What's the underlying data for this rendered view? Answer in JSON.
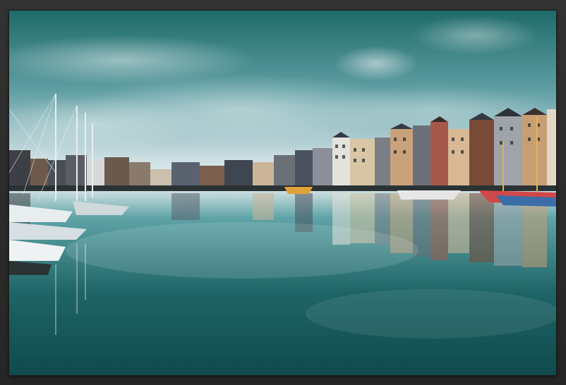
{
  "photo": {
    "scene": "harbor",
    "colors": {
      "frame": "#2b2b2b",
      "sky_top": "#1f6b6a",
      "sky_light": "#d7e6ea",
      "water_dark": "#0f4a4c",
      "water_light": "#5ea3a6"
    }
  }
}
